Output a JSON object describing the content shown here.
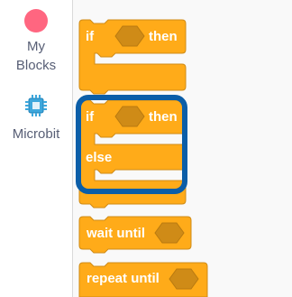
{
  "sidebar": {
    "categories": [
      {
        "label": "My Blocks",
        "color": "#ff6680",
        "icon": "circle-dot-icon"
      },
      {
        "label": "Microbit",
        "color": "#3ea7dc",
        "icon": "microchip-icon"
      }
    ]
  },
  "workspace": {
    "block_color": "#ffab19",
    "block_border": "#cf8b17",
    "blocks": [
      {
        "kind": "if-then",
        "if_label": "if",
        "then_label": "then"
      },
      {
        "kind": "if-then-else",
        "if_label": "if",
        "then_label": "then",
        "else_label": "else"
      },
      {
        "kind": "wait-until",
        "label": "wait until"
      },
      {
        "kind": "repeat-until",
        "label": "repeat until"
      }
    ],
    "highlight_color": "#0b5ea8"
  }
}
